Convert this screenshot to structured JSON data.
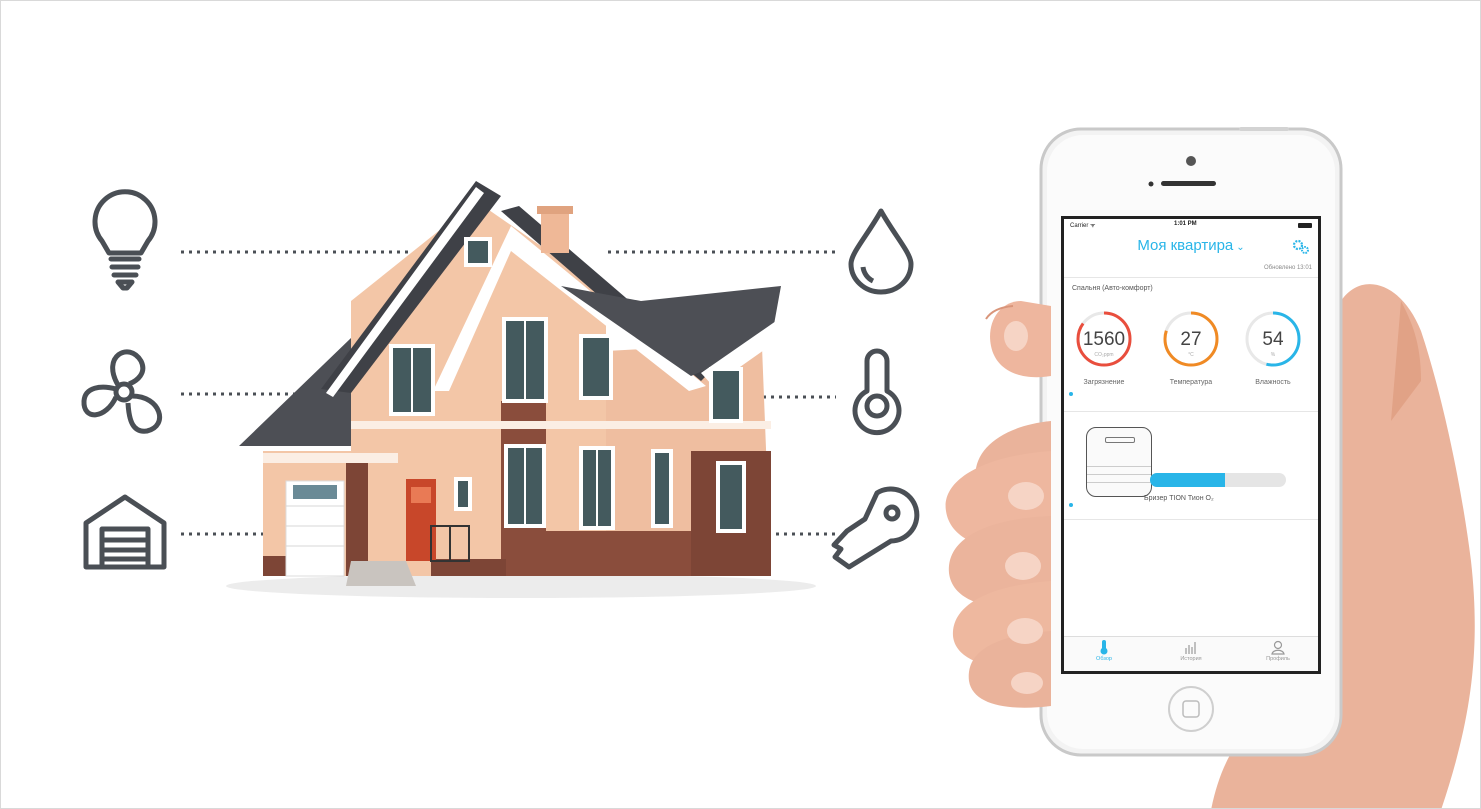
{
  "icons": [
    {
      "name": "light-bulb-icon"
    },
    {
      "name": "fan-icon"
    },
    {
      "name": "garage-icon"
    },
    {
      "name": "water-drop-icon"
    },
    {
      "name": "thermometer-icon"
    },
    {
      "name": "key-icon"
    }
  ],
  "colors": {
    "accent": "#29b5e8",
    "icon": "#4a4f55",
    "pollution": "#e94e3d",
    "temperature": "#f08a24",
    "humidity": "#29b5e8"
  },
  "phone": {
    "status": {
      "carrier": "Carrier ᯤ",
      "time": "1:01 PM"
    },
    "title": "Моя квартира",
    "updated": "Обновлено 13:01",
    "room": "Спальня (Авто-комфорт)",
    "gauges": [
      {
        "value": "1560",
        "unit": "CO₂ppm",
        "label": "Загрязнение",
        "level": 0.85
      },
      {
        "value": "27",
        "unit": "°C",
        "label": "Температура",
        "level": 0.8
      },
      {
        "value": "54",
        "unit": "%",
        "label": "Влажность",
        "level": 0.54
      }
    ],
    "device": {
      "name": "Бризер TION Тион O₂",
      "progress": 0.55
    },
    "tabs": [
      {
        "label": "Обзор",
        "active": true
      },
      {
        "label": "История",
        "active": false
      },
      {
        "label": "Профиль",
        "active": false
      }
    ]
  }
}
